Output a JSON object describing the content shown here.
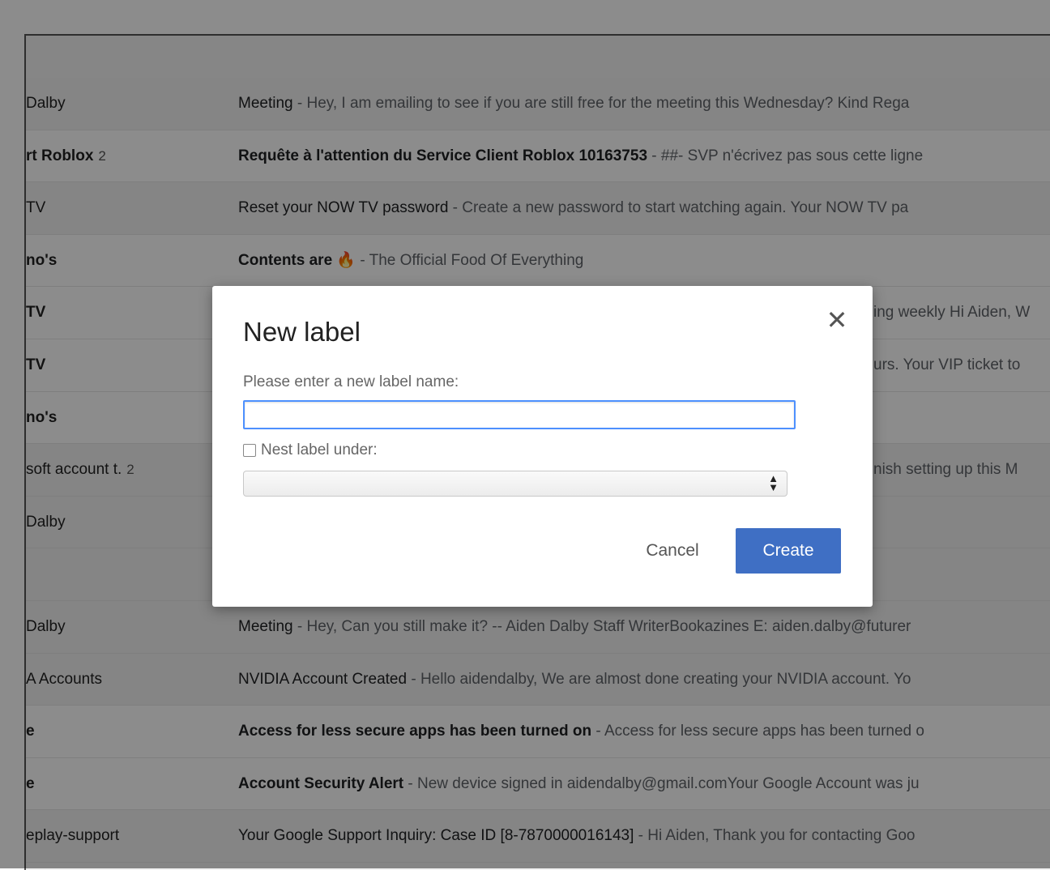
{
  "emails": [
    {
      "sender": "Dalby",
      "count": "",
      "subject": "Meeting",
      "snippet": "Hey, I am emailing to see if you are still free for the meeting this Wednesday? Kind Rega",
      "unread": false
    },
    {
      "sender": "rt Roblox",
      "count": "2",
      "subject": "Requête à l'attention du Service Client Roblox 10163753",
      "snippet": "##- SVP n'écrivez pas sous cette ligne",
      "unread": true
    },
    {
      "sender": "TV",
      "count": "",
      "subject": "Reset your NOW TV password",
      "snippet": "Create a new password to start watching again. Your NOW TV pa",
      "unread": false
    },
    {
      "sender": "no's",
      "count": "",
      "subject": "Contents are 🔥",
      "snippet": "The Official Food Of Everything",
      "unread": true
    },
    {
      "sender": "TV",
      "count": "",
      "subject": "",
      "snippet": "ing weekly Hi Aiden, W",
      "unread": true
    },
    {
      "sender": "TV",
      "count": "",
      "subject": "",
      "snippet": "urs. Your VIP ticket to",
      "unread": true
    },
    {
      "sender": "no's",
      "count": "",
      "subject": "",
      "snippet": "",
      "unread": true
    },
    {
      "sender": "soft account t.",
      "count": "2",
      "subject": "",
      "snippet": "nish setting up this M",
      "unread": false
    },
    {
      "sender": "Dalby",
      "count": "",
      "subject": "",
      "snippet": "",
      "unread": false
    },
    {
      "sender": "",
      "count": "",
      "subject": "",
      "snippet": "",
      "unread": false
    },
    {
      "sender": "Dalby",
      "count": "",
      "subject": "Meeting",
      "snippet": "Hey, Can you still make it? -- Aiden Dalby Staff WriterBookazines E: aiden.dalby@futurer",
      "unread": false
    },
    {
      "sender": "A Accounts",
      "count": "",
      "subject": "NVIDIA Account Created",
      "snippet": "Hello aidendalby, We are almost done creating your NVIDIA account. Yo",
      "unread": false
    },
    {
      "sender": "e",
      "count": "",
      "subject": "Access for less secure apps has been turned on",
      "snippet": "Access for less secure apps has been turned o",
      "unread": true
    },
    {
      "sender": "e",
      "count": "",
      "subject": "Account Security Alert",
      "snippet": "New device signed in aidendalby@gmail.comYour Google Account was ju",
      "unread": true
    },
    {
      "sender": "eplay-support",
      "count": "",
      "subject": "Your Google Support Inquiry: Case ID [8-7870000016143]",
      "snippet": "Hi Aiden, Thank you for contacting Goo",
      "unread": false
    }
  ],
  "dialog": {
    "title": "New label",
    "close_icon": "close-icon",
    "prompt": "Please enter a new label name:",
    "name_value": "",
    "nest_label": "Nest label under:",
    "nest_checked": false,
    "nest_selected": "",
    "cancel_label": "Cancel",
    "create_label": "Create"
  },
  "colors": {
    "accent": "#3f6fc4",
    "input_focus": "#4d90fe"
  }
}
